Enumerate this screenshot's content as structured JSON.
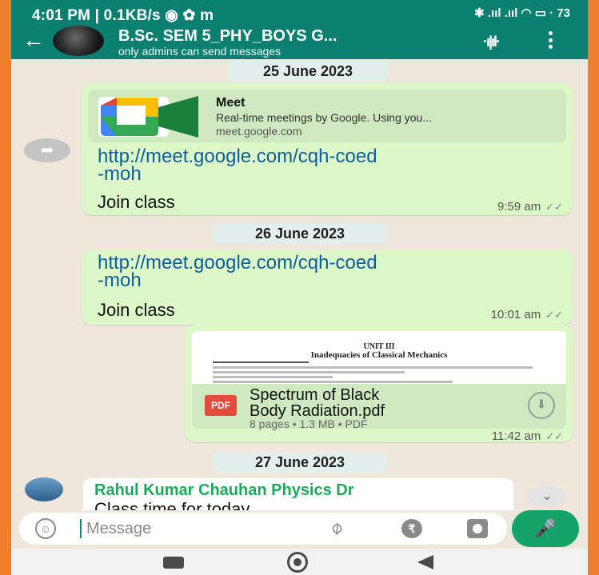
{
  "statusbar": {
    "left": "4:01 PM | 0.1KB/s ◉ ✿ m",
    "right": "✱ .ııl .ııl ◠ ▭ ·",
    "battery": "73"
  },
  "header": {
    "back_icon": "arrow-left-icon",
    "title": "B.Sc. SEM 5_PHY_BOYS G...",
    "subtitle": "only admins can send messages",
    "audio_icon": "waveform-icon",
    "menu_icon": "more-vert-icon"
  },
  "chat": {
    "date_1": "25 June 2023",
    "message_1": {
      "preview_title": "Meet",
      "preview_desc": "Real-time meetings by Google. Using you...",
      "preview_domain": "meet.google.com",
      "link": "http://meet.google.com/cqh-coed-moh",
      "link_line1": "http://meet.google.com/cqh-coed",
      "link_line2": "-moh",
      "text": "Join class",
      "time": "9:59 am"
    },
    "date_2": "26 June 2023",
    "message_2": {
      "link_line1": "http://meet.google.com/cqh-coed",
      "link_line2": "-moh",
      "text": "Join class",
      "time": "10:01 am"
    },
    "message_3": {
      "pdf_unit": "UNIT III",
      "pdf_heading": "Inadequacies of Classical Mechanics",
      "pdf_badge": "PDF",
      "pdf_name_line1": "Spectrum of Black",
      "pdf_name_line2": "Body Radiation.pdf",
      "pdf_meta": "8 pages • 1.3 MB • PDF",
      "time": "11:42 am"
    },
    "date_3": "27 June 2023",
    "incoming": {
      "sender": "Rahul Kumar Chauhan Physics Dr",
      "text": "Class time for today"
    }
  },
  "input": {
    "placeholder": "Message"
  },
  "colors": {
    "header": "#0b8071",
    "bubble_out": "#dcf8c6",
    "accent": "#14a46a",
    "background": "#efe6dc",
    "border_frame": "#ef7f2e"
  }
}
